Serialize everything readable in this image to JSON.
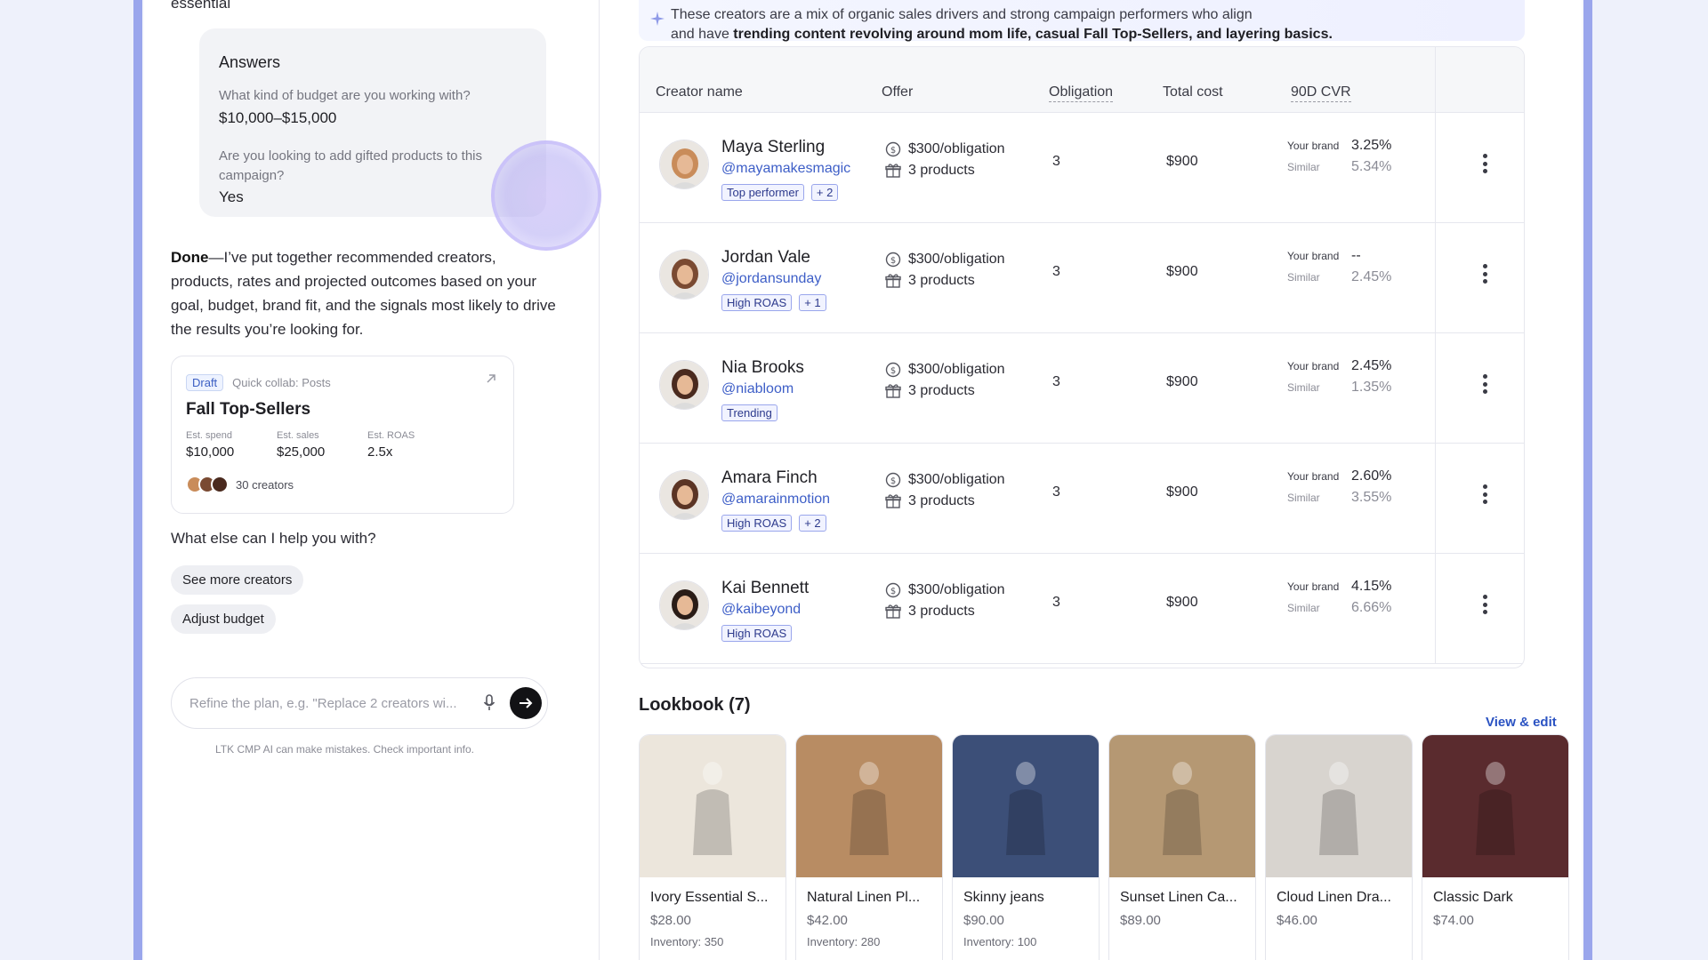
{
  "chat": {
    "top_text": "essential",
    "answers": {
      "heading": "Answers",
      "items": [
        {
          "q": "What kind of budget are you working with?",
          "a": "$10,000–$15,000"
        },
        {
          "q": "Are you looking to add gifted products to this campaign?",
          "a": "Yes"
        }
      ]
    },
    "done_bold": "Done",
    "done_text": "—I’ve put together recommended creators, products, rates and projected outcomes based on your goal, budget, brand fit, and the signals most likely to drive the results you’re looking for.",
    "plan": {
      "status": "Draft",
      "type": "Quick collab: Posts",
      "title": "Fall Top-Sellers",
      "stats": [
        {
          "label": "Est. spend",
          "value": "$10,000"
        },
        {
          "label": "Est. sales",
          "value": "$25,000"
        },
        {
          "label": "Est. ROAS",
          "value": "2.5x"
        }
      ],
      "creators": "30 creators"
    },
    "help": "What else can I help you with?",
    "chips": [
      "See more creators",
      "Adjust budget"
    ],
    "composer_placeholder": "Refine the plan, e.g. \"Replace 2 creators wi...",
    "disclaimer": "LTK CMP AI can make mistakes. Check important info."
  },
  "insight": {
    "line1": "These creators are a mix of organic sales drivers and strong campaign performers who align",
    "line2_pre": "and have ",
    "line2_bold": "trending content revolving around mom life, casual Fall Top-Sellers, and layering basics."
  },
  "table": {
    "headers": {
      "creator": "Creator name",
      "offer": "Offer",
      "obligation": "Obligation",
      "cost": "Total cost",
      "cvr": "90D CVR"
    },
    "cvr_your_label": "Your brand",
    "cvr_similar_label": "Similar",
    "rows": [
      {
        "name": "Maya Sterling",
        "handle": "@mayamakesmagic",
        "tags": [
          "Top performer",
          "+ 2"
        ],
        "rate": "$300/obligation",
        "products": "3 products",
        "obligation": "3",
        "cost": "$900",
        "your": "3.25%",
        "similar": "5.34%",
        "avatar_color": "#c98c5a"
      },
      {
        "name": "Jordan Vale",
        "handle": "@jordansunday",
        "tags": [
          "High ROAS",
          "+ 1"
        ],
        "rate": "$300/obligation",
        "products": "3 products",
        "obligation": "3",
        "cost": "$900",
        "your": "--",
        "similar": "2.45%",
        "avatar_color": "#7a4a32"
      },
      {
        "name": "Nia Brooks",
        "handle": "@niabloom",
        "tags": [
          "Trending"
        ],
        "rate": "$300/obligation",
        "products": "3 products",
        "obligation": "3",
        "cost": "$900",
        "your": "2.45%",
        "similar": "1.35%",
        "avatar_color": "#4a2a1e"
      },
      {
        "name": "Amara Finch",
        "handle": "@amarainmotion",
        "tags": [
          "High ROAS",
          "+ 2"
        ],
        "rate": "$300/obligation",
        "products": "3 products",
        "obligation": "3",
        "cost": "$900",
        "your": "2.60%",
        "similar": "3.55%",
        "avatar_color": "#5b3424"
      },
      {
        "name": "Kai Bennett",
        "handle": "@kaibeyond",
        "tags": [
          "High ROAS"
        ],
        "rate": "$300/obligation",
        "products": "3 products",
        "obligation": "3",
        "cost": "$900",
        "your": "4.15%",
        "similar": "6.66%",
        "avatar_color": "#2a1c16"
      }
    ]
  },
  "lookbook": {
    "title": "Lookbook (7)",
    "view_edit": "View & edit",
    "products": [
      {
        "name": "Ivory Essential S...",
        "price": "$28.00",
        "inventory": "Inventory: 350",
        "color": "#ece6dc"
      },
      {
        "name": "Natural Linen Pl...",
        "price": "$42.00",
        "inventory": "Inventory: 280",
        "color": "#b88c63"
      },
      {
        "name": "Skinny jeans",
        "price": "$90.00",
        "inventory": "Inventory: 100",
        "color": "#3c4f78"
      },
      {
        "name": "Sunset Linen Ca...",
        "price": "$89.00",
        "inventory": "",
        "color": "#b59873"
      },
      {
        "name": "Cloud Linen Dra...",
        "price": "$46.00",
        "inventory": "",
        "color": "#d8d4cf"
      },
      {
        "name": "Classic Dark",
        "price": "$74.00",
        "inventory": "",
        "color": "#5a2b2e"
      }
    ]
  }
}
